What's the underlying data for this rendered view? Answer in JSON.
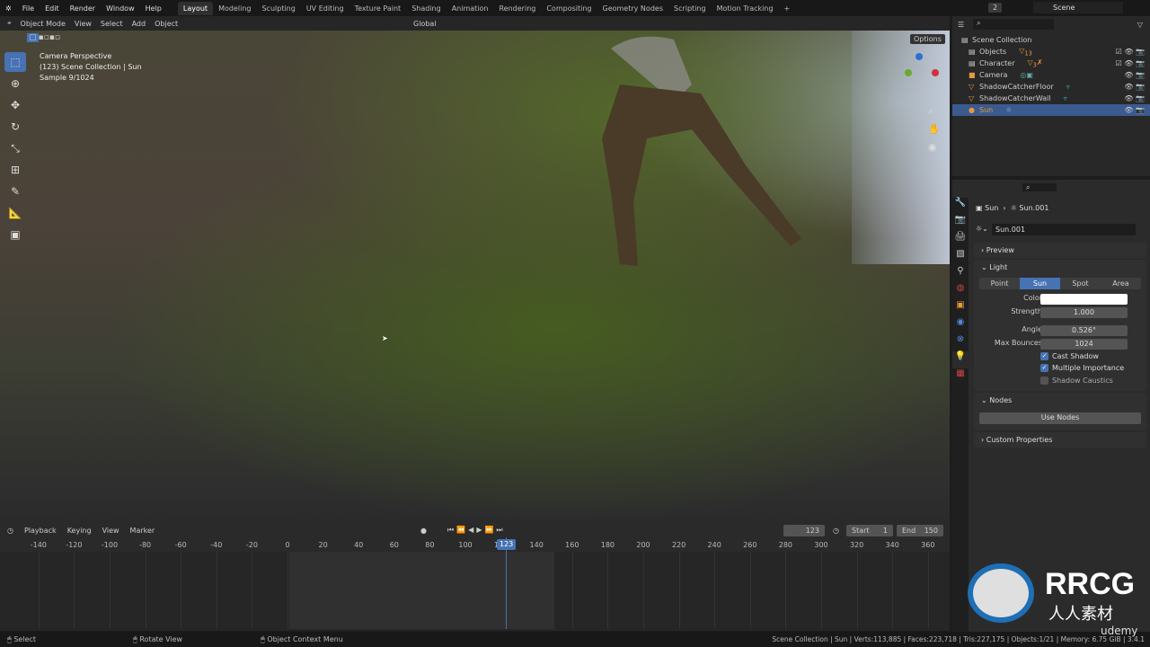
{
  "menu": [
    "File",
    "Edit",
    "Render",
    "Window",
    "Help"
  ],
  "workspaces": [
    "Layout",
    "Modeling",
    "Sculpting",
    "UV Editing",
    "Texture Paint",
    "Shading",
    "Animation",
    "Rendering",
    "Compositing",
    "Geometry Nodes",
    "Scripting",
    "Motion Tracking"
  ],
  "active_workspace": "Layout",
  "scene": {
    "users": "2",
    "name": "Scene"
  },
  "viewport_header": {
    "mode": "Object Mode",
    "menus": [
      "View",
      "Select",
      "Add",
      "Object"
    ],
    "orientation": "Global",
    "options": "Options"
  },
  "viewport_info": {
    "line1": "Camera Perspective",
    "line2": "(123) Scene Collection | Sun",
    "line3": "Sample 9/1024"
  },
  "outliner": {
    "root": "Scene Collection",
    "items": [
      {
        "name": "Objects",
        "badge": "13",
        "type": "collection"
      },
      {
        "name": "Character",
        "badge": "3",
        "type": "collection"
      },
      {
        "name": "Camera",
        "type": "camera"
      },
      {
        "name": "ShadowCatcherFloor",
        "type": "mesh"
      },
      {
        "name": "ShadowCatcherWall",
        "type": "mesh"
      },
      {
        "name": "Sun",
        "type": "light",
        "selected": true
      }
    ]
  },
  "properties": {
    "breadcrumb": [
      "Sun",
      "Sun.001"
    ],
    "datablock": "Sun.001",
    "panels": {
      "preview": "Preview",
      "light": "Light",
      "nodes": "Nodes",
      "custom": "Custom Properties"
    },
    "light_types": [
      "Point",
      "Sun",
      "Spot",
      "Area"
    ],
    "active_type": "Sun",
    "fields": {
      "color_label": "Color",
      "color": "#ffffff",
      "strength_label": "Strength",
      "strength": "1.000",
      "angle_label": "Angle",
      "angle": "0.526°",
      "bounces_label": "Max Bounces",
      "bounces": "1024"
    },
    "checks": [
      {
        "label": "Cast Shadow",
        "checked": true
      },
      {
        "label": "Multiple Importance",
        "checked": true
      },
      {
        "label": "Shadow Caustics",
        "checked": false
      }
    ],
    "use_nodes": "Use Nodes"
  },
  "timeline": {
    "menus": [
      "Playback",
      "Keying",
      "View",
      "Marker"
    ],
    "current_frame": "123",
    "start_label": "Start",
    "start": "1",
    "end_label": "End",
    "end": "150",
    "ticks": [
      "-140",
      "-120",
      "-100",
      "-80",
      "-60",
      "-40",
      "-20",
      "0",
      "20",
      "40",
      "60",
      "80",
      "100",
      "120",
      "140",
      "160",
      "180",
      "200",
      "220",
      "240",
      "260",
      "280",
      "300",
      "320",
      "340",
      "360"
    ]
  },
  "status": {
    "left": [
      "Select",
      "Rotate View",
      "Object Context Menu"
    ],
    "right": "Scene Collection | Sun | Verts:113,885 | Faces:223,718 | Tris:227,175 | Objects:1/21 | Memory: 6.75 GiB | 3.4.1"
  },
  "watermark": {
    "brand": "RRCG",
    "sub": "人人素材",
    "udemy": "udemy"
  },
  "accent": "#4772b3"
}
